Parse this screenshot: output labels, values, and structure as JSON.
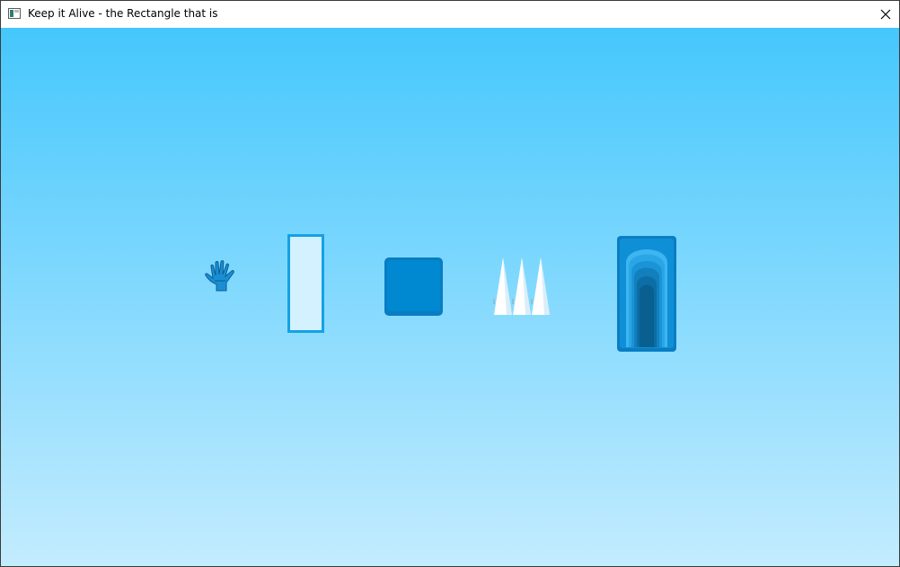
{
  "window": {
    "title": "Keep it Alive - the Rectangle that is",
    "close_glyph": "✕"
  },
  "icons": {
    "app": "app-window-icon",
    "close": "close-icon"
  },
  "colors": {
    "sky_top": "#45c7fd",
    "sky_bottom": "#c3ecfe",
    "accent_blue": "#0088d1",
    "rectangle_fill": "#d3f1ff",
    "rectangle_border": "#14a1e6",
    "spike_white": "#ffffff"
  },
  "scene": {
    "sprites": [
      "hand-cursor-icon",
      "player-rectangle",
      "solid-block",
      "spike-trap",
      "exit-portal"
    ]
  }
}
